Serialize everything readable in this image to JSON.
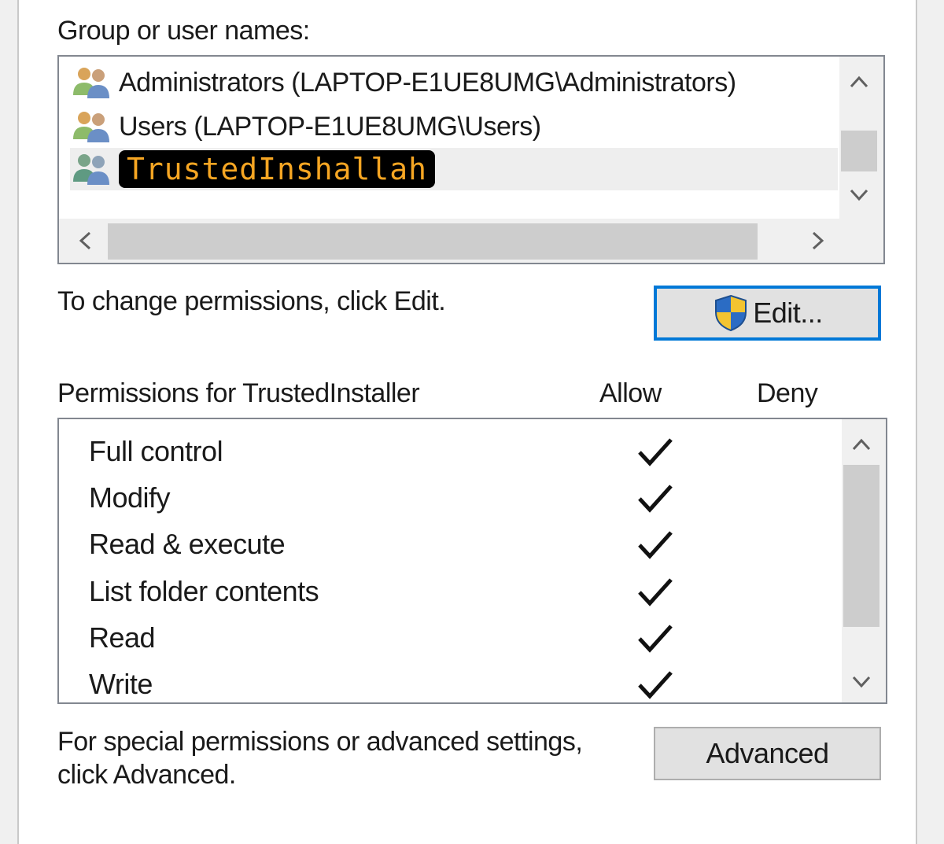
{
  "group_section": {
    "label": "Group or user names:",
    "entries": [
      {
        "name": "Administrators (LAPTOP-E1UE8UMG\\Administrators)",
        "icon": "users-group-icon"
      },
      {
        "name": "Users (LAPTOP-E1UE8UMG\\Users)",
        "icon": "users-group-icon"
      },
      {
        "name": "TrustedInshallah",
        "icon": "users-group-icon",
        "selected": true,
        "highlight_color": "#f6a623"
      }
    ]
  },
  "edit_section": {
    "hint": "To change permissions, click Edit.",
    "edit_button": {
      "label": "Edit...",
      "icon": "uac-shield-icon"
    }
  },
  "permissions_section": {
    "label": "Permissions for TrustedInstaller",
    "allow_header": "Allow",
    "deny_header": "Deny",
    "rows": [
      {
        "name": "Full control",
        "allow": true,
        "deny": false
      },
      {
        "name": "Modify",
        "allow": true,
        "deny": false
      },
      {
        "name": "Read & execute",
        "allow": true,
        "deny": false
      },
      {
        "name": "List folder contents",
        "allow": true,
        "deny": false
      },
      {
        "name": "Read",
        "allow": true,
        "deny": false
      },
      {
        "name": "Write",
        "allow": true,
        "deny": false
      }
    ]
  },
  "advanced_section": {
    "hint_line1": "For special permissions or advanced settings,",
    "hint_line2": "click Advanced.",
    "advanced_button": {
      "label": "Advanced"
    }
  },
  "colors": {
    "accent": "#0078d7",
    "highlight_bg": "#000000",
    "highlight_text": "#f6a623"
  }
}
